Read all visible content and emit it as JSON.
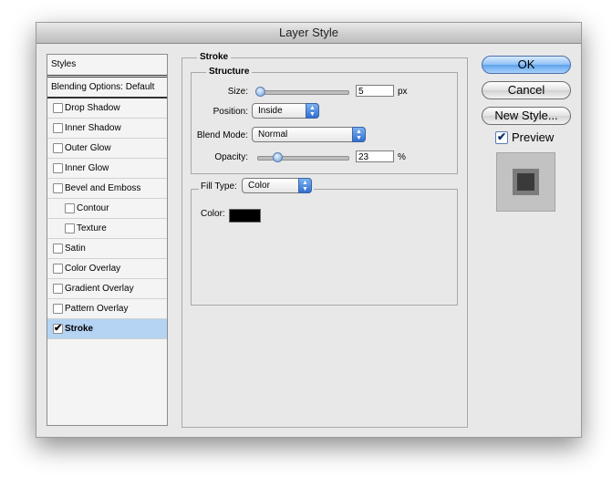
{
  "window": {
    "title": "Layer Style"
  },
  "styles": {
    "header": "Styles",
    "blending": "Blending Options: Default",
    "items": [
      {
        "label": "Drop Shadow",
        "checked": false
      },
      {
        "label": "Inner Shadow",
        "checked": false
      },
      {
        "label": "Outer Glow",
        "checked": false
      },
      {
        "label": "Inner Glow",
        "checked": false
      },
      {
        "label": "Bevel and Emboss",
        "checked": false
      },
      {
        "label": "Contour",
        "checked": false
      },
      {
        "label": "Texture",
        "checked": false
      },
      {
        "label": "Satin",
        "checked": false
      },
      {
        "label": "Color Overlay",
        "checked": false
      },
      {
        "label": "Gradient Overlay",
        "checked": false
      },
      {
        "label": "Pattern Overlay",
        "checked": false
      },
      {
        "label": "Stroke",
        "checked": true
      }
    ]
  },
  "stroke": {
    "title": "Stroke",
    "structure": {
      "title": "Structure",
      "size_label": "Size:",
      "size_value": "5",
      "size_unit": "px",
      "position_label": "Position:",
      "position_value": "Inside",
      "blend_label": "Blend Mode:",
      "blend_value": "Normal",
      "opacity_label": "Opacity:",
      "opacity_value": "23",
      "opacity_unit": "%"
    },
    "fill": {
      "type_label": "Fill Type:",
      "type_value": "Color",
      "color_label": "Color:",
      "color_hex": "#000000"
    }
  },
  "buttons": {
    "ok": "OK",
    "cancel": "Cancel",
    "new_style": "New Style..."
  },
  "preview": {
    "label": "Preview",
    "checked": true
  },
  "check_glyph": "✔"
}
